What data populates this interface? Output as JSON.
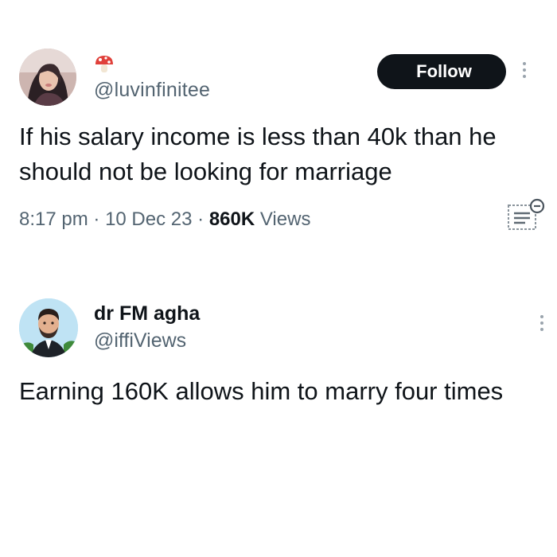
{
  "tweet1": {
    "handle": "@luvinfinitee",
    "follow_label": "Follow",
    "text": "If his salary income is less than 40k than he should not be looking for marriage",
    "time": "8:17 pm",
    "separator": "·",
    "date": "10 Dec 23",
    "views_count": "860K",
    "views_label": "Views"
  },
  "tweet2": {
    "name": "dr FM agha",
    "handle": "@iffiViews",
    "text": "Earning 160K allows him to marry four times"
  },
  "colors": {
    "text_primary": "#0f1419",
    "text_secondary": "#536471",
    "follow_bg": "#0f1419",
    "follow_text": "#ffffff"
  },
  "icons": {
    "tweet1_emoji": "mushroom-icon",
    "more": "more-vertical-icon",
    "translate": "translate-icon"
  }
}
